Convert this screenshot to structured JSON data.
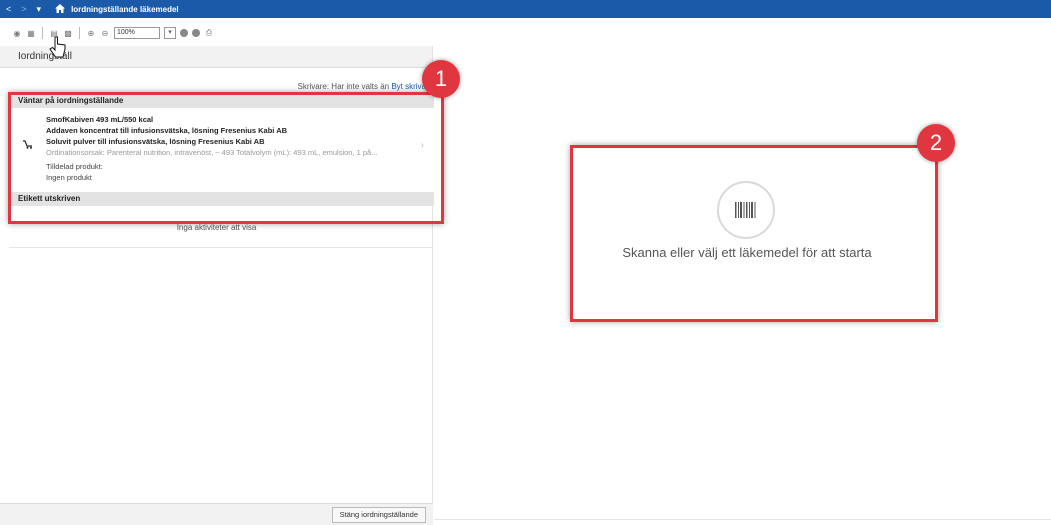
{
  "titlebar": {
    "back": "<",
    "forward": ">",
    "menu": "▾",
    "title": "Iordningställande läkemedel",
    "actions": [
      {
        "label": "Helskärm"
      },
      {
        "label": "Skriv ut"
      },
      {
        "label": "2 minuter se"
      }
    ]
  },
  "toolbar": {
    "zoom": "100%"
  },
  "left": {
    "tab": "Iordningställ",
    "printer_text": "Skrivare: Har inte valts än",
    "printer_link": "Byt skriva",
    "group_waiting": "Väntar på iordningställande",
    "item": {
      "line1": "SmofKabiven 493 mL/550 kcal",
      "line2": "Addaven koncentrat till infusionsvätska, lösning Fresenius Kabi AB",
      "line3": "Soluvit pulver till infusionsvätska, lösning Fresenius Kabi AB",
      "details": "Ordinationsorsak: Parenteral nutrition, intravenöst, ~ 493 Totalvolym (mL): 493 mL, emulsion, 1 på...",
      "assigned_label": "Tilldelad produkt:",
      "assigned_value": "Ingen produkt"
    },
    "group_printed": "Etikett utskriven",
    "no_activities": "Inga aktiviteter att visa",
    "close_button": "Stäng iordningställande"
  },
  "right": {
    "scan_prompt": "Skanna eller välj ett läkemedel för att starta"
  },
  "annotations": {
    "badge1": "1",
    "badge2": "2",
    "color": "#e0363f"
  }
}
